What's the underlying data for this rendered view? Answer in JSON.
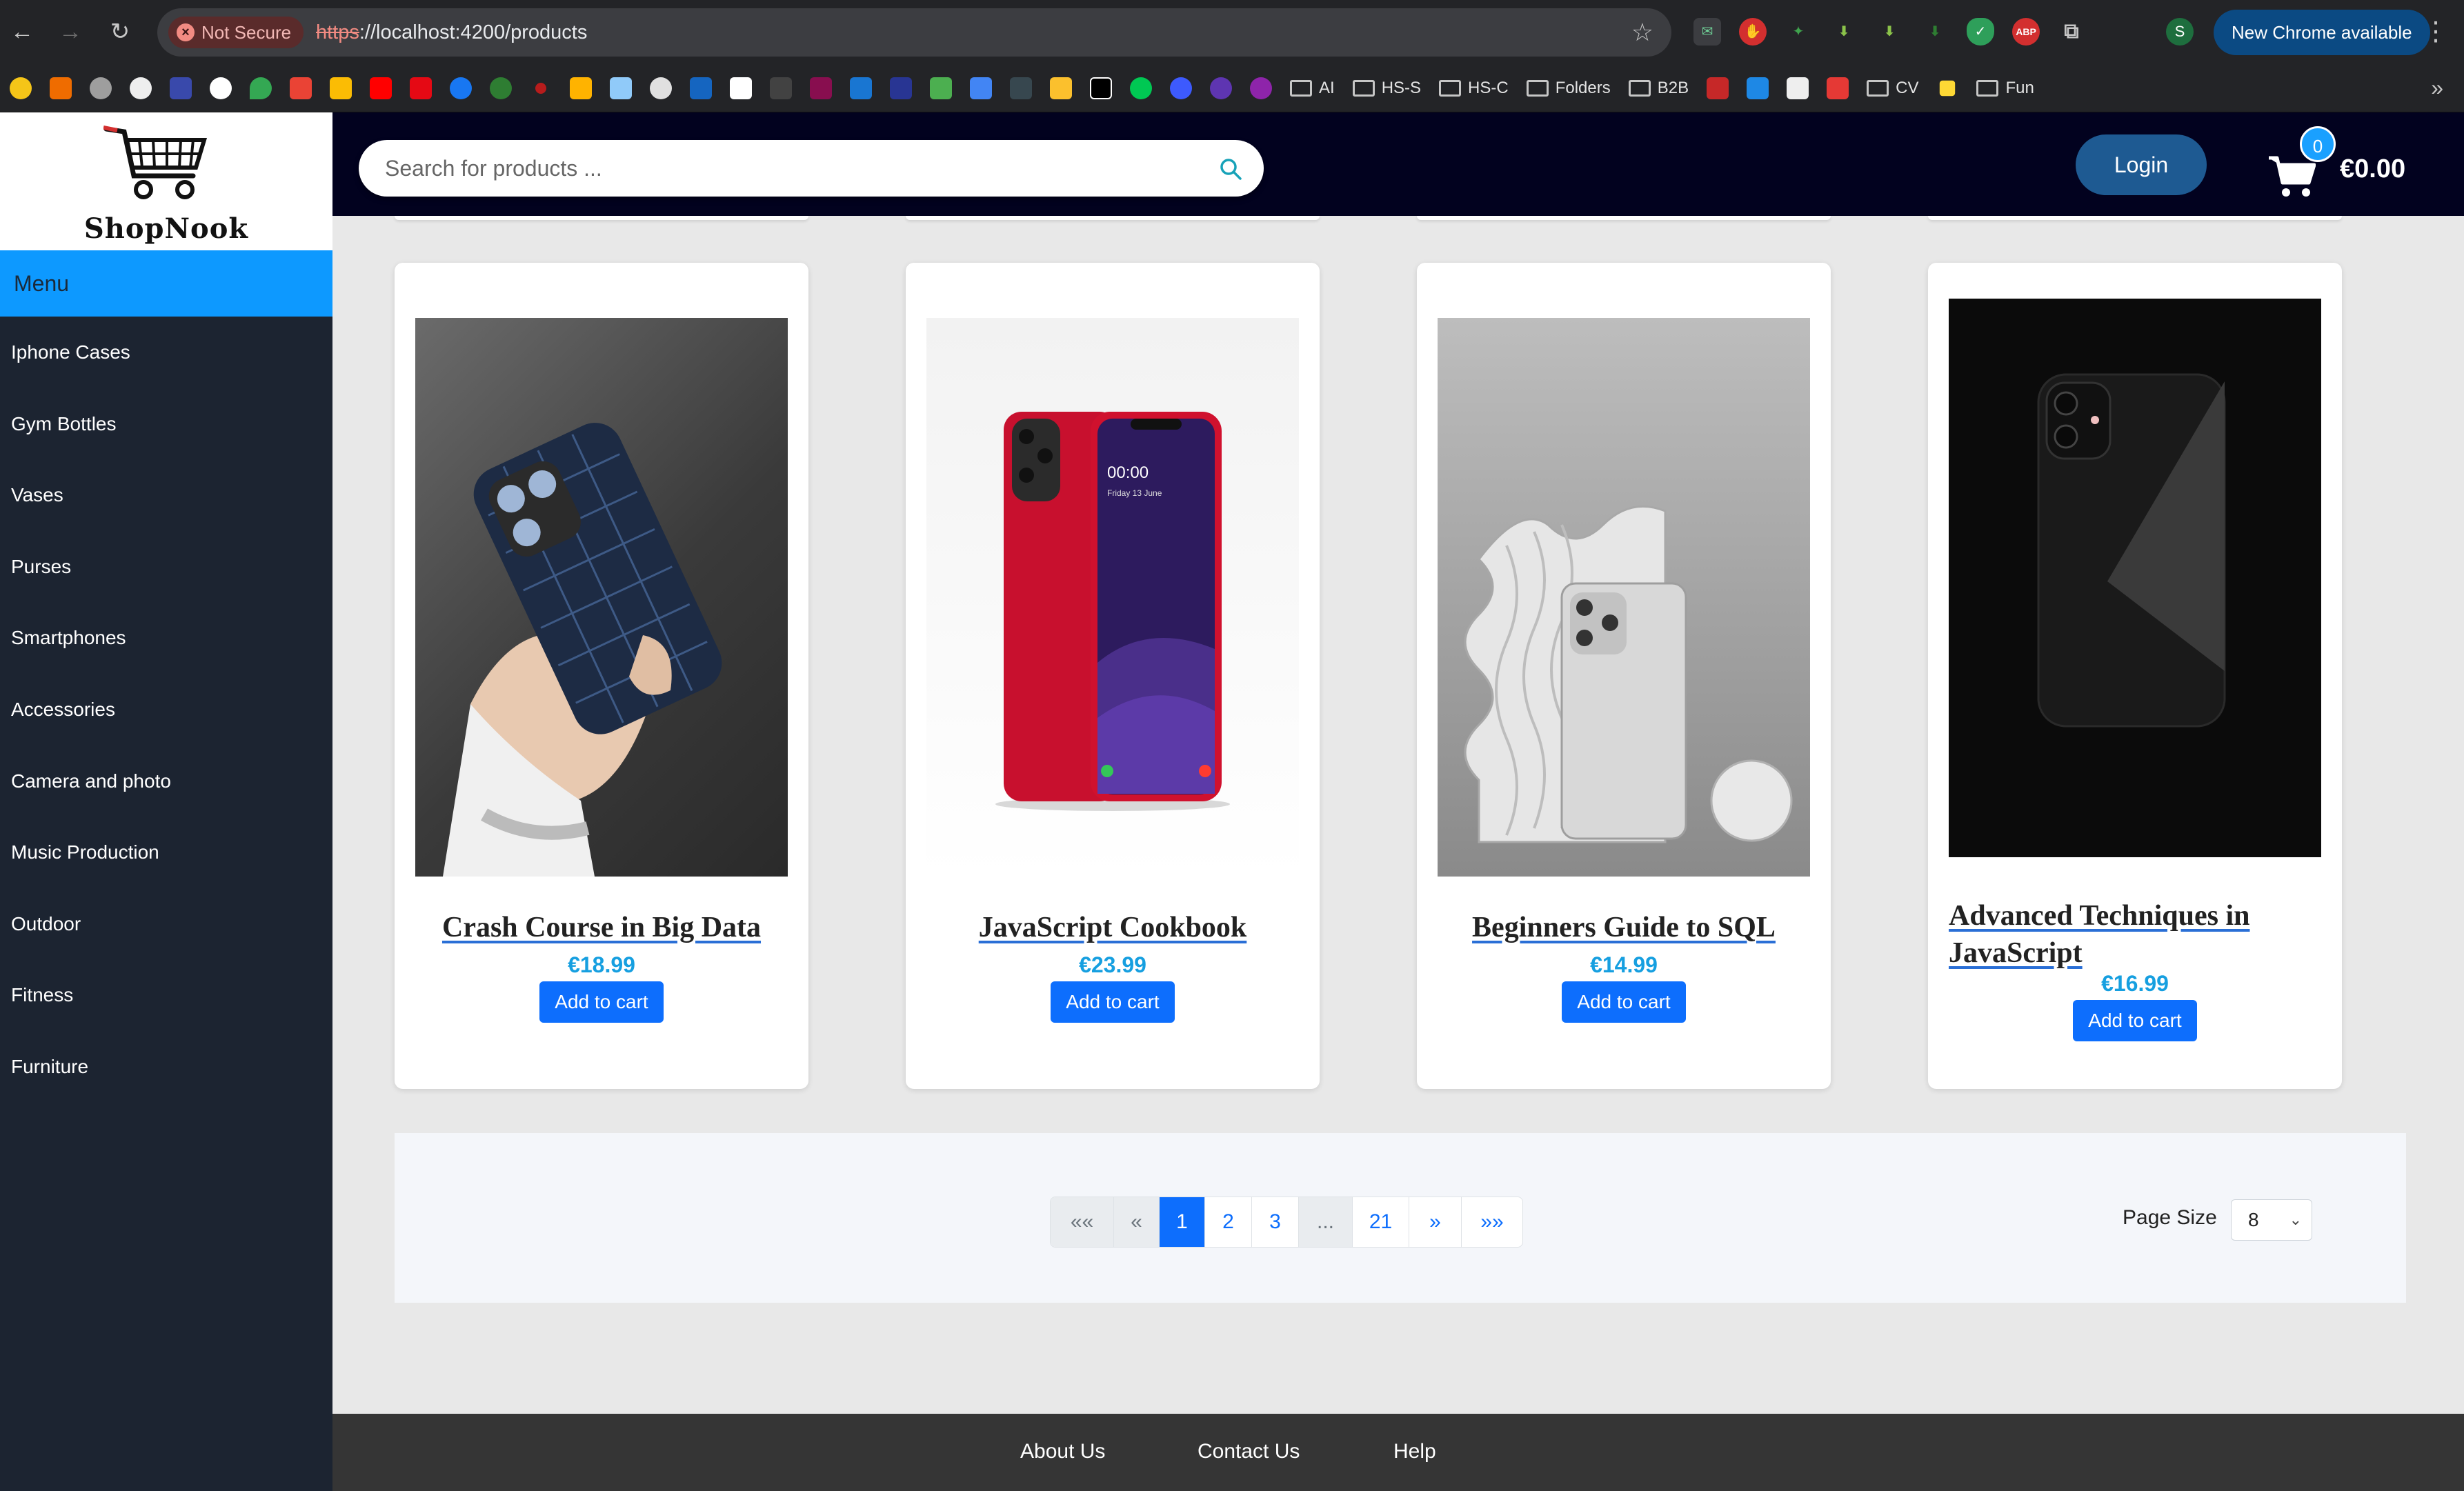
{
  "browser": {
    "security_label": "Not Secure",
    "url_scheme": "https",
    "url_rest": "://localhost:4200/products",
    "update_label": "New Chrome available",
    "profile_initial": "S",
    "bookmark_folders": [
      "AI",
      "HS-S",
      "HS-C",
      "Folders",
      "B2B",
      "CV",
      "Fun"
    ]
  },
  "sidebar": {
    "logo_text": "ShopNook",
    "menu_label": "Menu",
    "categories": [
      "Iphone Cases",
      "Gym Bottles",
      "Vases",
      "Purses",
      "Smartphones",
      "Accessories",
      "Camera and photo",
      "Music Production",
      "Outdoor",
      "Fitness",
      "Furniture"
    ]
  },
  "topbar": {
    "search_placeholder": "Search for products ...",
    "login_label": "Login",
    "cart_count": "0",
    "cart_total": "€0.00"
  },
  "products": [
    {
      "title": "Crash Course in Big Data",
      "price": "€18.99",
      "button": "Add to cart",
      "image": "hand-holding-croc-phone-case"
    },
    {
      "title": "JavaScript Cookbook",
      "price": "€23.99",
      "button": "Add to cart",
      "image": "red-smartphone"
    },
    {
      "title": "Beginners Guide to SQL",
      "price": "€14.99",
      "button": "Add to cart",
      "image": "silver-phone-on-wave-stand"
    },
    {
      "title": "Advanced Techniques in JavaScript",
      "price": "€16.99",
      "button": "Add to cart",
      "image": "black-phone-case-dark"
    }
  ],
  "pagination": {
    "first": "««",
    "prev": "«",
    "pages": [
      "1",
      "2",
      "3",
      "...",
      "21"
    ],
    "active": "1",
    "next": "»",
    "last": "»»",
    "page_size_label": "Page Size",
    "page_size_value": "8"
  },
  "footer": {
    "links": [
      "About Us",
      "Contact Us",
      "Help"
    ]
  },
  "colors": {
    "topbar": "#02021f",
    "sidebar": "#1c2431",
    "menu_header": "#0d99ff",
    "primary_button": "#0d6efd",
    "price": "#169fe0",
    "login": "#1e5a92"
  }
}
